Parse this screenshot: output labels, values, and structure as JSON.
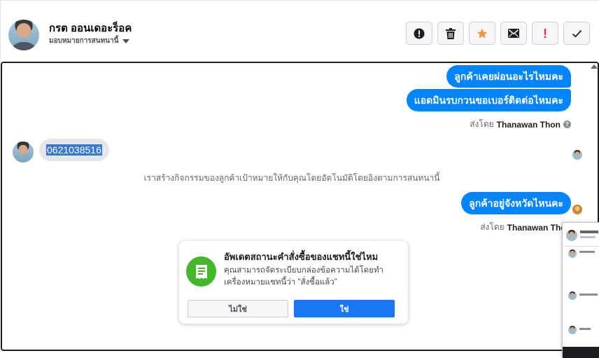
{
  "header": {
    "contact_name": "กรต ออนเดอะร็อค",
    "assign_label": "มอบหมายการสนทนานี้"
  },
  "toolbar": {
    "spam_icon": "alert-circle-icon",
    "delete_icon": "trash-icon",
    "star_icon": "star-icon",
    "mail_icon": "envelope-icon",
    "flag_label": "!",
    "done_icon": "checkmark-icon",
    "star_color": "#f7923b",
    "flag_color": "#f02849"
  },
  "messages": {
    "out_1": "ลูกค้าเคยผ่อนอะไรไหมคะ",
    "out_2": "แอดมินรบกวนขอเบอร์ติดต่อไหมคะ",
    "sent_by_prefix": "ส่งโดย",
    "sent_by_name": "Thanawan Thon",
    "in_1": "0621038516",
    "system_note": "เราสร้างกิจกรรมของลูกค้าเป้าหมายให้กับคุณโดยอัตโนมัติโดยอิงตามการสนทนานี้",
    "out_3": "ลูกค้าอยู่จังหวัดไหนคะ"
  },
  "card": {
    "title": "อัพเดตสถานะคำสั่งซื้อของแชทนี้ใช่ไหม",
    "body": "คุณสามารถจัดระเบียบกล่องข้อความได้โดยทำเครื่องหมายแชทนี้ว่า \"สั่งซื้อแล้ว\"",
    "no_label": "ไม่ใช่",
    "yes_label": "ใช่",
    "icon": "receipt-icon",
    "accent_color": "#42b72a",
    "primary_color": "#1877f2"
  },
  "colors": {
    "bubble_out": "#0084ff",
    "bubble_in": "#e4e6eb"
  }
}
